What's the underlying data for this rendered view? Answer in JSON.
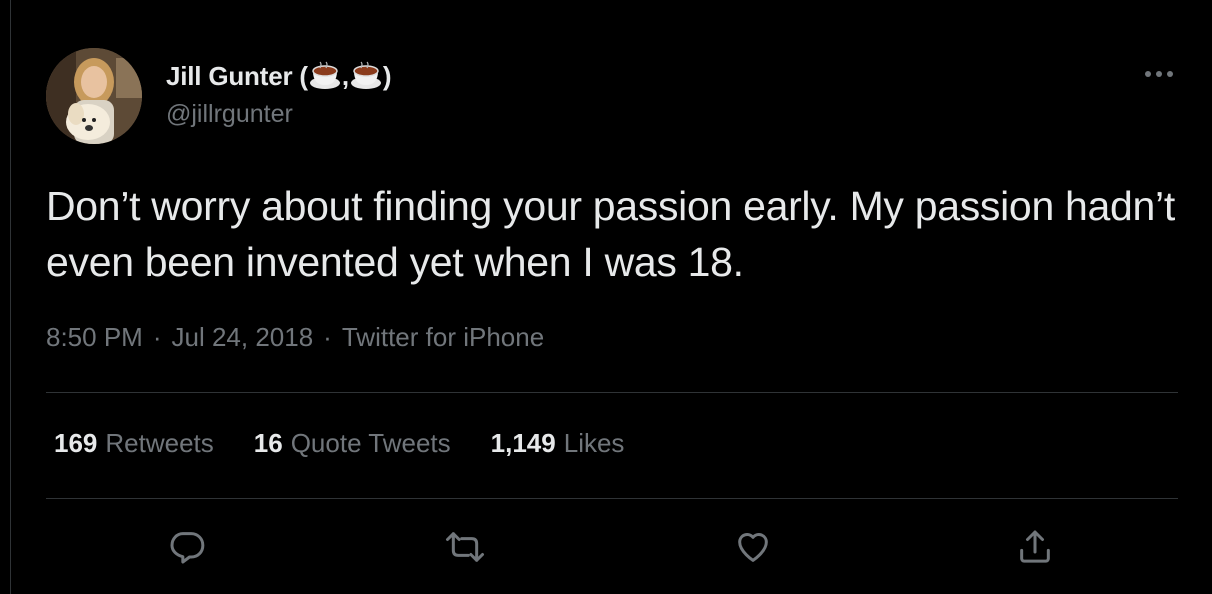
{
  "author": {
    "name": "Jill Gunter (",
    "name_sep": ",",
    "name_close": ")",
    "handle": "@jillrgunter",
    "avatar_icon": "profile-photo"
  },
  "tweet": {
    "text": "Don’t worry about finding your passion early. My passion hadn’t even been invented yet when I was 18.",
    "time": "8:50 PM",
    "sep1": "·",
    "date": "Jul 24, 2018",
    "sep2": "·",
    "source": "Twitter for iPhone"
  },
  "stats": {
    "retweets": {
      "count": "169",
      "label": "Retweets"
    },
    "quotes": {
      "count": "16",
      "label": "Quote Tweets"
    },
    "likes": {
      "count": "1,149",
      "label": "Likes"
    }
  },
  "actions": [
    "reply-icon",
    "retweet-icon",
    "like-icon",
    "share-icon"
  ],
  "colors": {
    "background": "#000000",
    "text": "#e7e9ea",
    "secondary": "#71767b",
    "divider": "#2f3336"
  }
}
